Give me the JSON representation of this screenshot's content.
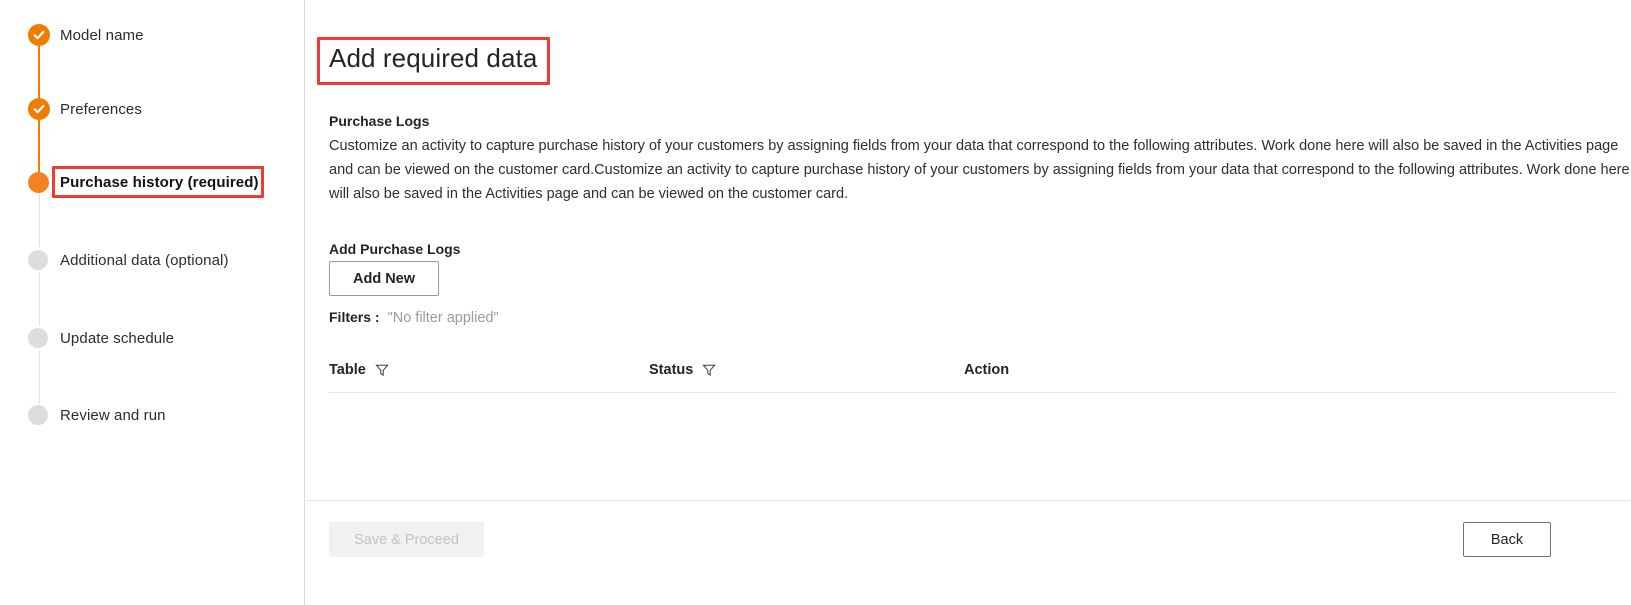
{
  "sidebar": {
    "steps": [
      {
        "label": "Model name",
        "state": "done",
        "marker_icon": "check-circle-icon"
      },
      {
        "label": "Preferences",
        "state": "done",
        "marker_icon": "check-circle-icon"
      },
      {
        "label": "Purchase history (required)",
        "state": "current",
        "marker_icon": "filled-circle-icon"
      },
      {
        "label": "Additional data (optional)",
        "state": "pending",
        "marker_icon": "empty-circle-icon"
      },
      {
        "label": "Update schedule",
        "state": "pending",
        "marker_icon": "empty-circle-icon"
      },
      {
        "label": "Review and run",
        "state": "pending",
        "marker_icon": "empty-circle-icon"
      }
    ]
  },
  "main": {
    "page_title": "Add required data",
    "purchase_logs_label": "Purchase Logs",
    "description": "Customize an activity to capture purchase history of your customers by assigning fields from your data that correspond to the following attributes. Work done here will also be saved in the Activities page and can be viewed on the customer card.Customize an activity to capture purchase history of your customers by assigning fields from your data that correspond to the following attributes. Work done here will also be saved in the Activities page and can be viewed on the customer card.",
    "add_purchase_logs_label": "Add Purchase Logs",
    "add_new_label": "Add New",
    "filters_label": "Filters :",
    "filters_value": "\"No filter applied\"",
    "table": {
      "columns": [
        {
          "header": "Table",
          "filter_icon": "funnel-icon"
        },
        {
          "header": "Status",
          "filter_icon": "funnel-icon"
        },
        {
          "header": "Action",
          "filter_icon": null
        }
      ],
      "rows": []
    }
  },
  "footer": {
    "save_label": "Save & Proceed",
    "save_disabled": true,
    "back_label": "Back"
  },
  "annotations": {
    "box_color": "#ee3b33",
    "targets": [
      "page-title",
      "sidebar-step-purchase-history"
    ]
  },
  "colors": {
    "accent_orange": "#ef7d00",
    "current_orange": "#f58220",
    "pending_grey": "#dddddd",
    "annotation_red": "#ee3b33",
    "text_primary": "#23232b",
    "muted_text": "#9b9ba3"
  }
}
